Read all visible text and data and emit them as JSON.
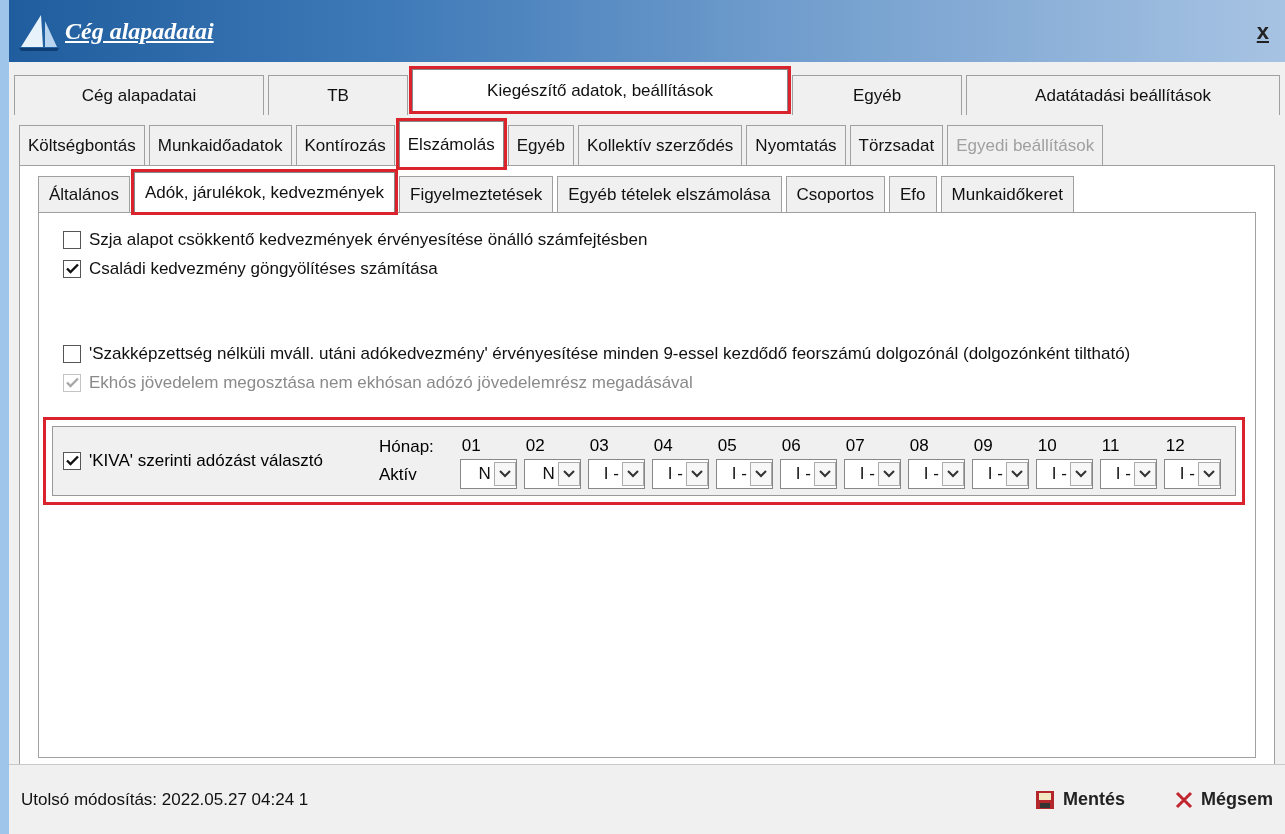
{
  "window": {
    "title": "Cég alapadatai",
    "close": "x"
  },
  "tabs_main": [
    {
      "label": "Cég alapadatai",
      "selected": false
    },
    {
      "label": "TB",
      "selected": false
    },
    {
      "label": "Kiegészítő adatok, beállítások",
      "selected": true
    },
    {
      "label": "Egyéb",
      "selected": false
    },
    {
      "label": "Adatátadási beállítások",
      "selected": false
    }
  ],
  "tabs_sub": [
    {
      "label": "Költségbontás",
      "selected": false,
      "disabled": false
    },
    {
      "label": "Munkaidőadatok",
      "selected": false,
      "disabled": false
    },
    {
      "label": "Kontírozás",
      "selected": false,
      "disabled": false
    },
    {
      "label": "Elszámolás",
      "selected": true,
      "disabled": false
    },
    {
      "label": "Egyéb",
      "selected": false,
      "disabled": false
    },
    {
      "label": "Kollektív szerződés",
      "selected": false,
      "disabled": false
    },
    {
      "label": "Nyomtatás",
      "selected": false,
      "disabled": false
    },
    {
      "label": "Törzsadat",
      "selected": false,
      "disabled": false
    },
    {
      "label": "Egyedi beállítások",
      "selected": false,
      "disabled": true
    }
  ],
  "tabs_inner": [
    {
      "label": "Általános",
      "selected": false
    },
    {
      "label": "Adók, járulékok, kedvezmények",
      "selected": true
    },
    {
      "label": "Figyelmeztetések",
      "selected": false
    },
    {
      "label": "Egyéb tételek elszámolása",
      "selected": false
    },
    {
      "label": "Csoportos",
      "selected": false
    },
    {
      "label": "Efo",
      "selected": false
    },
    {
      "label": "Munkaidőkeret",
      "selected": false
    }
  ],
  "options_top": [
    {
      "label": "Szja alapot csökkentő kedvezmények érvényesítése önálló számfejtésben",
      "checked": false,
      "disabled": false
    },
    {
      "label": "Családi kedvezmény göngyölítéses számítása",
      "checked": true,
      "disabled": false
    }
  ],
  "options_bottom": [
    {
      "label": "'Szakképzettség nélküli mváll. utáni adókedvezmény' érvényesítése minden 9-essel kezdődő feorszámú dolgozónál (dolgozónként tiltható)",
      "checked": false,
      "disabled": false
    },
    {
      "label": "Ekhós jövedelem megosztása nem ekhósan adózó jövedelemrész megadásával",
      "checked": true,
      "disabled": true
    }
  ],
  "kiva": {
    "label": "'KIVA' szerinti adózást választó",
    "checked": true,
    "highlighted": true,
    "month_label": "Hónap:",
    "active_label": "Aktív",
    "months": [
      {
        "month": "01",
        "value": "N"
      },
      {
        "month": "02",
        "value": "N"
      },
      {
        "month": "03",
        "value": "I -"
      },
      {
        "month": "04",
        "value": "I -"
      },
      {
        "month": "05",
        "value": "I -"
      },
      {
        "month": "06",
        "value": "I -"
      },
      {
        "month": "07",
        "value": "I -"
      },
      {
        "month": "08",
        "value": "I -"
      },
      {
        "month": "09",
        "value": "I -"
      },
      {
        "month": "10",
        "value": "I -"
      },
      {
        "month": "11",
        "value": "I -"
      },
      {
        "month": "12",
        "value": "I -"
      }
    ]
  },
  "status": {
    "last_modified": "Utolsó módosítás: 2022.05.27 04:24 1"
  },
  "buttons": [
    {
      "kind": "save",
      "label": "Mentés"
    },
    {
      "kind": "cancel",
      "label": "Mégsem"
    }
  ]
}
